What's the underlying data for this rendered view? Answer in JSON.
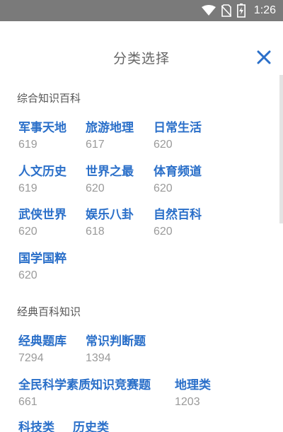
{
  "status_bar": {
    "time": "1:26"
  },
  "header": {
    "title": "分类选择"
  },
  "sections": [
    {
      "title": "综合知识百科",
      "items": [
        {
          "label": "军事天地",
          "count": "619"
        },
        {
          "label": "旅游地理",
          "count": "617"
        },
        {
          "label": "日常生活",
          "count": "620"
        },
        {
          "label": "人文历史",
          "count": "619"
        },
        {
          "label": "世界之最",
          "count": "620"
        },
        {
          "label": "体育频道",
          "count": "620"
        },
        {
          "label": "武侠世界",
          "count": "620"
        },
        {
          "label": "娱乐八卦",
          "count": "618"
        },
        {
          "label": "自然百科",
          "count": "620"
        },
        {
          "label": "国学国粹",
          "count": "620"
        }
      ]
    },
    {
      "title": "经典百科知识",
      "items": [
        {
          "label": "经典题库",
          "count": "7294"
        },
        {
          "label": "常识判断题",
          "count": "1394"
        },
        {
          "label": "全民科学素质知识竞赛题",
          "count": "661"
        },
        {
          "label": "地理类",
          "count": "1203"
        },
        {
          "label": "科技类",
          "count": ""
        },
        {
          "label": "历史类",
          "count": ""
        }
      ]
    }
  ],
  "colors": {
    "accent": "#2a6fc9",
    "title": "#666666",
    "count": "#9a9a9a",
    "status_bar": "#7a7a7a"
  }
}
